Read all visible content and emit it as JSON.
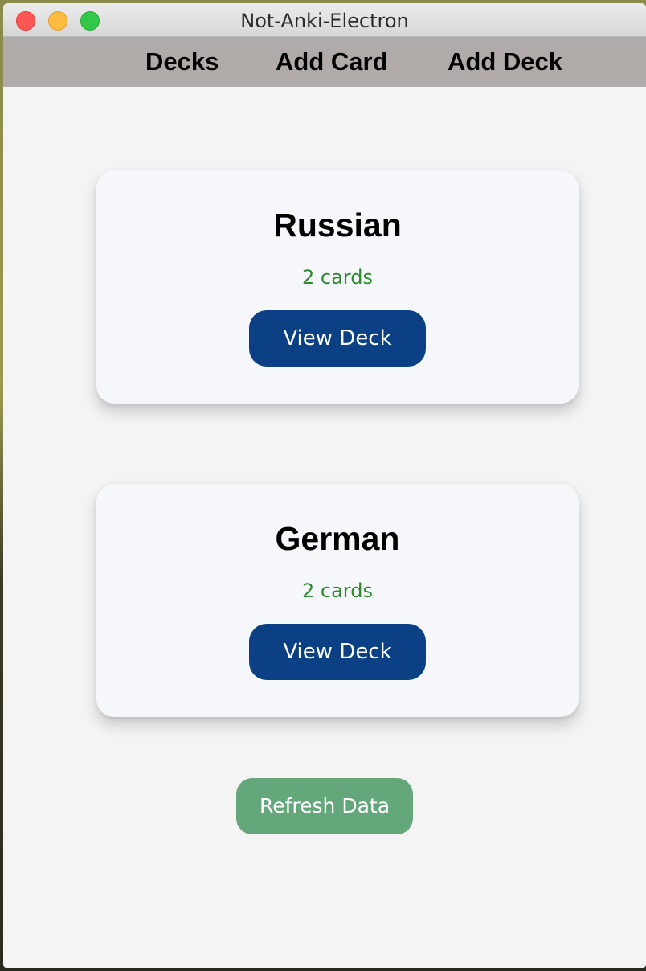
{
  "window": {
    "title": "Not-Anki-Electron"
  },
  "nav": {
    "items": [
      {
        "label": "Decks"
      },
      {
        "label": "Add Card"
      },
      {
        "label": "Add Deck"
      }
    ]
  },
  "decks": [
    {
      "name": "Russian",
      "count": "2 cards",
      "button_label": "View Deck"
    },
    {
      "name": "German",
      "count": "2 cards",
      "button_label": "View Deck"
    }
  ],
  "actions": {
    "refresh_label": "Refresh Data"
  },
  "colors": {
    "nav_bg": "#b0aaa8",
    "card_bg": "#f6f7fb",
    "count_text": "#2e8a2e",
    "view_button": "#0b4184",
    "refresh_button": "#64a77b"
  },
  "icons": [
    "close-icon",
    "minimize-icon",
    "maximize-icon"
  ]
}
